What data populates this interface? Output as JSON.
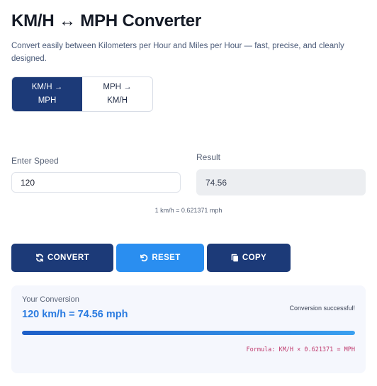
{
  "header": {
    "title": "KM/H ↔ MPH Converter",
    "subtitle": "Convert easily between Kilometers per Hour and Miles per Hour — fast, precise, and cleanly designed."
  },
  "mode_toggle": {
    "options": [
      {
        "label": "KM/H →\nMPH",
        "active": true
      },
      {
        "label": "MPH →\nKM/H",
        "active": false
      }
    ]
  },
  "input": {
    "label": "Enter Speed",
    "value": "120"
  },
  "result": {
    "label": "Result",
    "value": "74.56"
  },
  "rate_note": "1 km/h = 0.621371 mph",
  "buttons": {
    "convert": {
      "label": "CONVERT",
      "icon": "refresh-icon"
    },
    "reset": {
      "label": "RESET",
      "icon": "undo-icon"
    },
    "copy": {
      "label": "COPY",
      "icon": "copy-icon"
    }
  },
  "conversion_panel": {
    "label": "Your Conversion",
    "value": "120 km/h = 74.56 mph",
    "status": "Conversion successful!",
    "progress": 1.0,
    "formula": "Formula: KM/H × 0.621371 = MPH"
  },
  "colors": {
    "primary": "#1c3a78",
    "accent": "#2a8ef0",
    "result_text": "#2a7be0",
    "formula": "#c03a6e"
  }
}
